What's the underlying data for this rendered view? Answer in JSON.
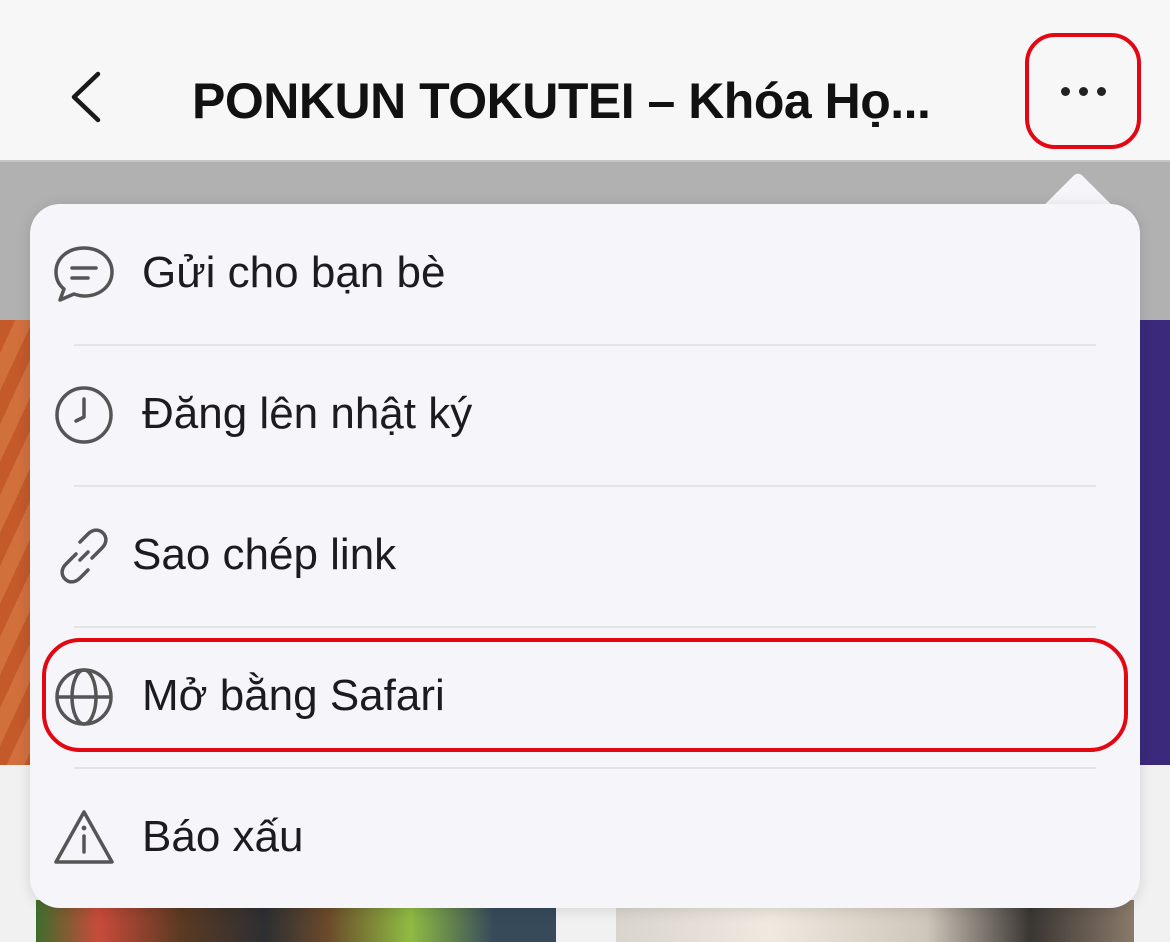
{
  "header": {
    "title": "PONKUN TOKUTEI – Khóa Họ..."
  },
  "menu": {
    "items": [
      {
        "label": "Gửi cho bạn bè",
        "icon": "chat-bubble-icon"
      },
      {
        "label": "Đăng lên nhật ký",
        "icon": "clock-icon"
      },
      {
        "label": "Sao chép link",
        "icon": "link-icon"
      },
      {
        "label": "Mở bằng Safari",
        "icon": "globe-icon"
      },
      {
        "label": "Báo xấu",
        "icon": "warning-icon"
      }
    ]
  },
  "colors": {
    "highlight": "#e30613",
    "menu_bg": "#f6f5fa",
    "header_bg": "#f7f7f7"
  }
}
